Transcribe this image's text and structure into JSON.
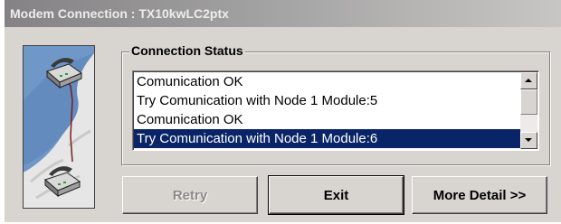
{
  "window": {
    "title": "Modem Connection : TX10kwLC2ptx"
  },
  "status_group": {
    "title": "Connection Status",
    "log": [
      "Comunication OK",
      "Try Comunication with Node 1 Module:5",
      "Comunication OK",
      "Try Comunication with Node 1 Module:6"
    ],
    "selected_index": 3
  },
  "buttons": {
    "retry": "Retry",
    "exit": "Exit",
    "more": "More Detail >>"
  },
  "icons": [
    "telephone-icon",
    "telephone-icon",
    "scroll-up-arrow-icon",
    "scroll-down-arrow-icon"
  ],
  "colors": {
    "dialog_bg": "#d8d4d0",
    "selection": "#0a2468"
  }
}
